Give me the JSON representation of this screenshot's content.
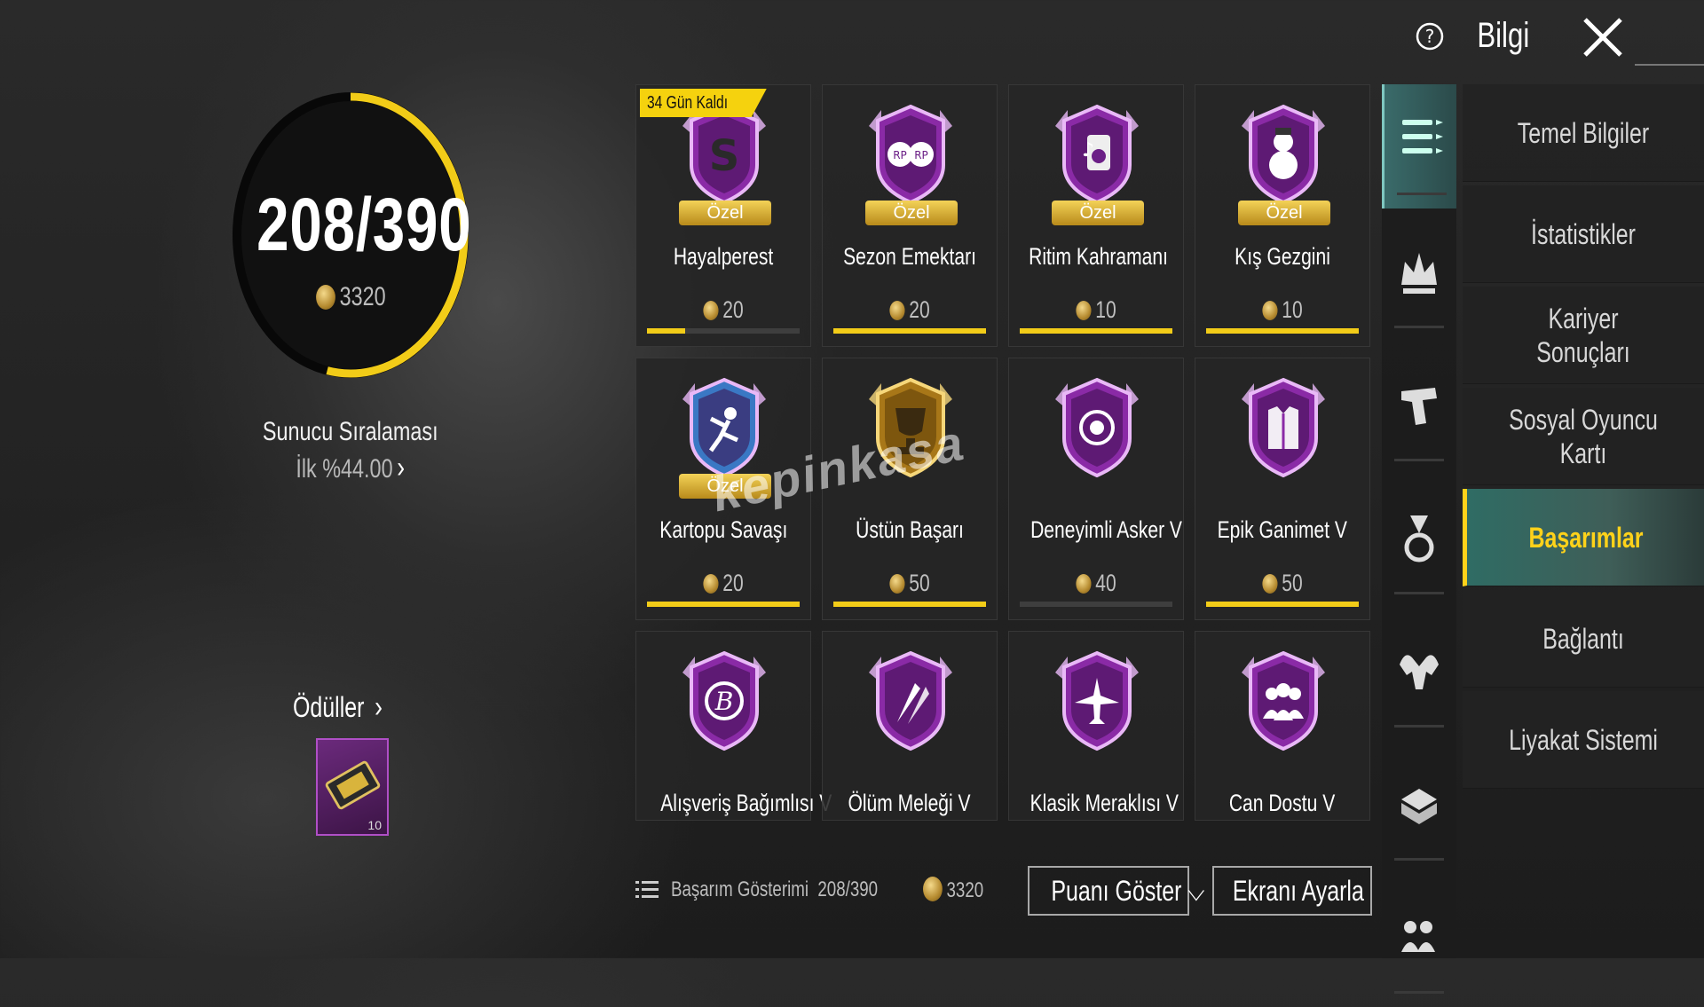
{
  "header": {
    "info_label": "Bilgi"
  },
  "progress": {
    "count": "208/390",
    "points": "3320",
    "fraction": 0.533,
    "accent": "#f2cc18",
    "rank_title": "Sunucu Sıralaması",
    "rank_value": "İlk %44.00",
    "rewards_label": "Ödüller",
    "reward_qty": "10"
  },
  "achievements": [
    {
      "title": "Hayalperest",
      "points": "20",
      "special": "Özel",
      "tag": "34 Gün Kaldı",
      "progress": 0.25,
      "icon": "s-emblem-icon"
    },
    {
      "title": "Sezon Emektarı",
      "points": "20",
      "special": "Özel",
      "progress": 1.0,
      "icon": "rp-badge-icon"
    },
    {
      "title": "Ritim Kahramanı",
      "points": "10",
      "special": "Özel",
      "progress": 1.0,
      "icon": "music-icon"
    },
    {
      "title": "Kış Gezgini",
      "points": "10",
      "special": "Özel",
      "progress": 1.0,
      "icon": "snowman-icon"
    },
    {
      "title": "Kartopu Savaşı",
      "points": "20",
      "special": "Özel",
      "progress": 1.0,
      "icon": "snowball-fighter-icon"
    },
    {
      "title": "Üstün Başarı",
      "points": "50",
      "progress": 1.0,
      "icon": "trophy-icon"
    },
    {
      "title": "Deneyimli Asker V",
      "points": "40",
      "progress": 0.0,
      "icon": "soldier-emblem-icon"
    },
    {
      "title": "Epik Ganimet V",
      "points": "50",
      "progress": 1.0,
      "icon": "armor-icon"
    },
    {
      "title": "Alışveriş Bağımlısı V",
      "points": "",
      "icon": "shopping-icon"
    },
    {
      "title": "Ölüm Meleği V",
      "points": "",
      "icon": "rockets-icon"
    },
    {
      "title": "Klasik Meraklısı V",
      "points": "",
      "icon": "airplane-icon"
    },
    {
      "title": "Can Dostu V",
      "points": "",
      "icon": "squad-icon"
    }
  ],
  "bottom": {
    "display_label": "Başarım Gösterimi",
    "display_count": "208/390",
    "points": "3320",
    "show_points_button": "Puanı Göster",
    "adjust_screen_button": "Ekranı Ayarla"
  },
  "rail_icons": [
    "list-icon",
    "crown-icon",
    "pistol-icon",
    "medal-icon",
    "muscle-icon",
    "crate-icon",
    "team-icon"
  ],
  "menu": [
    {
      "label": "Temel Bilgiler"
    },
    {
      "label": "İstatistikler"
    },
    {
      "label": "Kariyer Sonuçları"
    },
    {
      "label": "Sosyal Oyuncu Kartı"
    },
    {
      "label": "Başarımlar",
      "active": true
    },
    {
      "label": "Bağlantı"
    },
    {
      "label": "Liyakat Sistemi"
    }
  ],
  "watermark": "kepinkasa",
  "colors": {
    "accent_yellow": "#f2cc18",
    "menu_active": "#2f6c64",
    "badge_purple": "#b24bd1"
  }
}
